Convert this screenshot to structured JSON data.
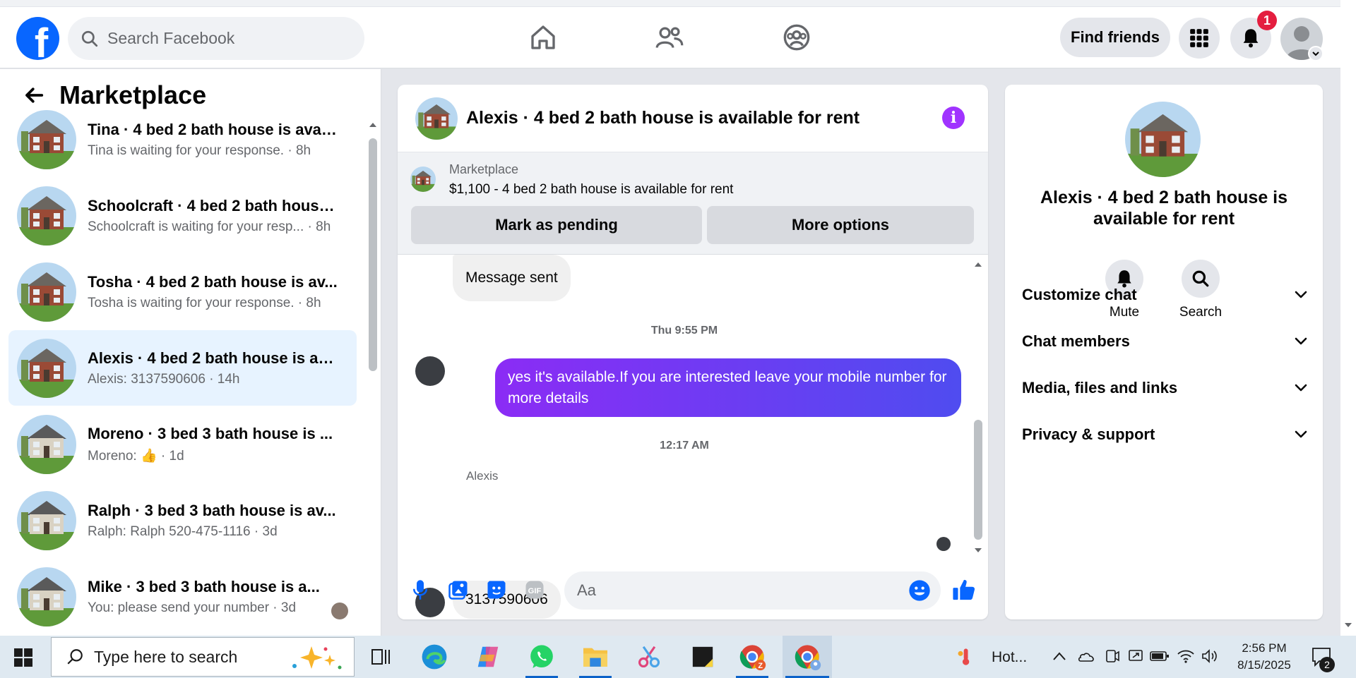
{
  "topnav": {
    "search_placeholder": "Search Facebook",
    "find_friends": "Find friends",
    "notification_count": "1"
  },
  "left": {
    "title": "Marketplace",
    "conversations": [
      {
        "title": "Tina · 4 bed 2 bath house is avai...",
        "subtitle": "Tina is waiting for your response. · 8h",
        "active": false
      },
      {
        "title": "Schoolcraft · 4 bed 2 bath house...",
        "subtitle": "Schoolcraft is waiting for your resp... · 8h",
        "active": false
      },
      {
        "title": "Tosha · 4 bed 2 bath house is av...",
        "subtitle": "Tosha is waiting for your response. · 8h",
        "active": false
      },
      {
        "title": "Alexis · 4 bed 2 bath house is av...",
        "subtitle": "Alexis: 3137590606 · 14h",
        "active": true
      },
      {
        "title": "Moreno · 3 bed 3 bath house is ...",
        "subtitle": "Moreno: 👍 · 1d",
        "active": false
      },
      {
        "title": "Ralph · 3 bed 3 bath house is av...",
        "subtitle": "Ralph: Ralph 520-475-1116 · 3d",
        "active": false
      },
      {
        "title": "Mike · 3 bed 3 bath house is a...",
        "subtitle": "You: please send your number · 3d",
        "active": false
      }
    ]
  },
  "chat": {
    "title": "Alexis · 4 bed 2 bath house is available for rent",
    "marketplace_label": "Marketplace",
    "listing": "$1,100 - 4 bed 2 bath house is available for rent",
    "mark_pending": "Mark as pending",
    "more_options": "More options",
    "messages": {
      "first": "Message sent",
      "ts1": "Thu 9:55 PM",
      "outgoing": "yes it's available.If you are interested leave your mobile number for more details",
      "ts2": "12:17 AM",
      "sender": "Alexis",
      "incoming": "3137590606"
    },
    "composer_placeholder": "Aa"
  },
  "right": {
    "title": "Alexis · 4 bed 2 bath house is available for rent",
    "mute": "Mute",
    "search": "Search",
    "sections": [
      "Customize chat",
      "Chat members",
      "Media, files and links",
      "Privacy & support"
    ]
  },
  "taskbar": {
    "search_placeholder": "Type here to search",
    "weather": "Hot...",
    "time": "2:56 PM",
    "date": "8/15/2025",
    "notif_count": "2"
  },
  "colors": {
    "brand": "#0866ff",
    "outgoing_gradient_start": "#8b2cf5",
    "outgoing_gradient_end": "#4f4cf0",
    "active_row": "#e7f3ff"
  }
}
